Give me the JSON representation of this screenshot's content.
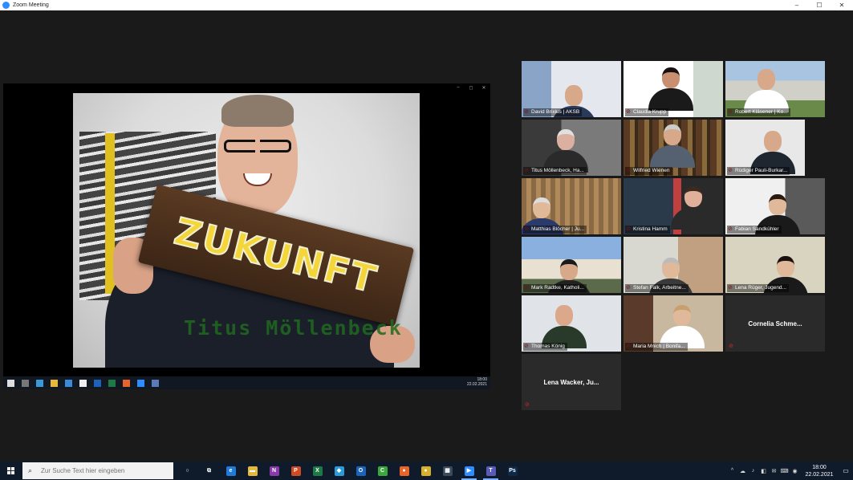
{
  "window": {
    "title": "Zoom Meeting",
    "controls": [
      "–",
      "☐",
      "✕"
    ]
  },
  "share": {
    "window_controls": [
      "–",
      "◻",
      "✕"
    ],
    "sign_text": "ZUKUNFT",
    "overlay_name": "Titus Möllenbeck",
    "mini_clock_time": "18:00",
    "mini_clock_date": "22.02.2021"
  },
  "gallery": {
    "active_speaker_color": "#c9e32a",
    "participants": [
      {
        "name": "David Brixius | AKSB",
        "video": true
      },
      {
        "name": "Claudia Krupp",
        "video": true
      },
      {
        "name": "Robert Kläsener | Ko...",
        "video": true,
        "active": true
      },
      {
        "name": "Titus Möllenbeck, Ha...",
        "video": true
      },
      {
        "name": "Wilfried Wienen",
        "video": true
      },
      {
        "name": "Rüdiger Pauli-Burkar...",
        "video": true
      },
      {
        "name": "Matthias Blöcher | Ju...",
        "video": true
      },
      {
        "name": "Kristina Hamm",
        "video": true
      },
      {
        "name": "Fabian Sandkühler",
        "video": true
      },
      {
        "name": "Mark Radtke, Katholi...",
        "video": true
      },
      {
        "name": "Stefan Falk, Arbeitne...",
        "video": true
      },
      {
        "name": "Lena Rüger, Jugend...",
        "video": true
      },
      {
        "name": "Thomas König",
        "video": true
      },
      {
        "name": "Maria Mnich | Bonifa...",
        "video": true
      },
      {
        "name": "Cornelia  Schme...",
        "video": false
      },
      {
        "name": "Lena  Wacker,  Ju...",
        "video": false
      }
    ]
  },
  "taskbar": {
    "search_placeholder": "Zur Suche Text hier eingeben",
    "apps": [
      {
        "icon": "cortana-icon",
        "glyph": "○",
        "color": "#0f1a2a"
      },
      {
        "icon": "task-view-icon",
        "glyph": "⧉",
        "color": "#0f1a2a"
      },
      {
        "icon": "edge-icon",
        "glyph": "e",
        "color": "#1f7ad8"
      },
      {
        "icon": "file-explorer-icon",
        "glyph": "▬",
        "color": "#e8b83a"
      },
      {
        "icon": "onenote-icon",
        "glyph": "N",
        "color": "#8a3aa8"
      },
      {
        "icon": "powerpoint-icon",
        "glyph": "P",
        "color": "#d04a22"
      },
      {
        "icon": "excel-icon",
        "glyph": "X",
        "color": "#1e7a44"
      },
      {
        "icon": "maps-icon",
        "glyph": "◆",
        "color": "#2a9ad8"
      },
      {
        "icon": "outlook-icon",
        "glyph": "O",
        "color": "#1c62b8"
      },
      {
        "icon": "camtasia-icon",
        "glyph": "C",
        "color": "#3aa83a"
      },
      {
        "icon": "firefox-icon",
        "glyph": "●",
        "color": "#e8642a"
      },
      {
        "icon": "chrome-icon",
        "glyph": "●",
        "color": "#d8b02a"
      },
      {
        "icon": "calculator-icon",
        "glyph": "▦",
        "color": "#3a4a5a"
      },
      {
        "icon": "zoom-icon",
        "glyph": "▶",
        "color": "#2d8cff",
        "open": true
      },
      {
        "icon": "teams-icon",
        "glyph": "T",
        "color": "#5a5ab8",
        "open": true
      },
      {
        "icon": "photoshop-icon",
        "glyph": "Ps",
        "color": "#0c2a48"
      }
    ],
    "tray_icons": [
      "^",
      "☁",
      "♪",
      "◧",
      "✉",
      "⌨",
      "◉"
    ],
    "time": "18:00",
    "date": "22.02.2021"
  }
}
